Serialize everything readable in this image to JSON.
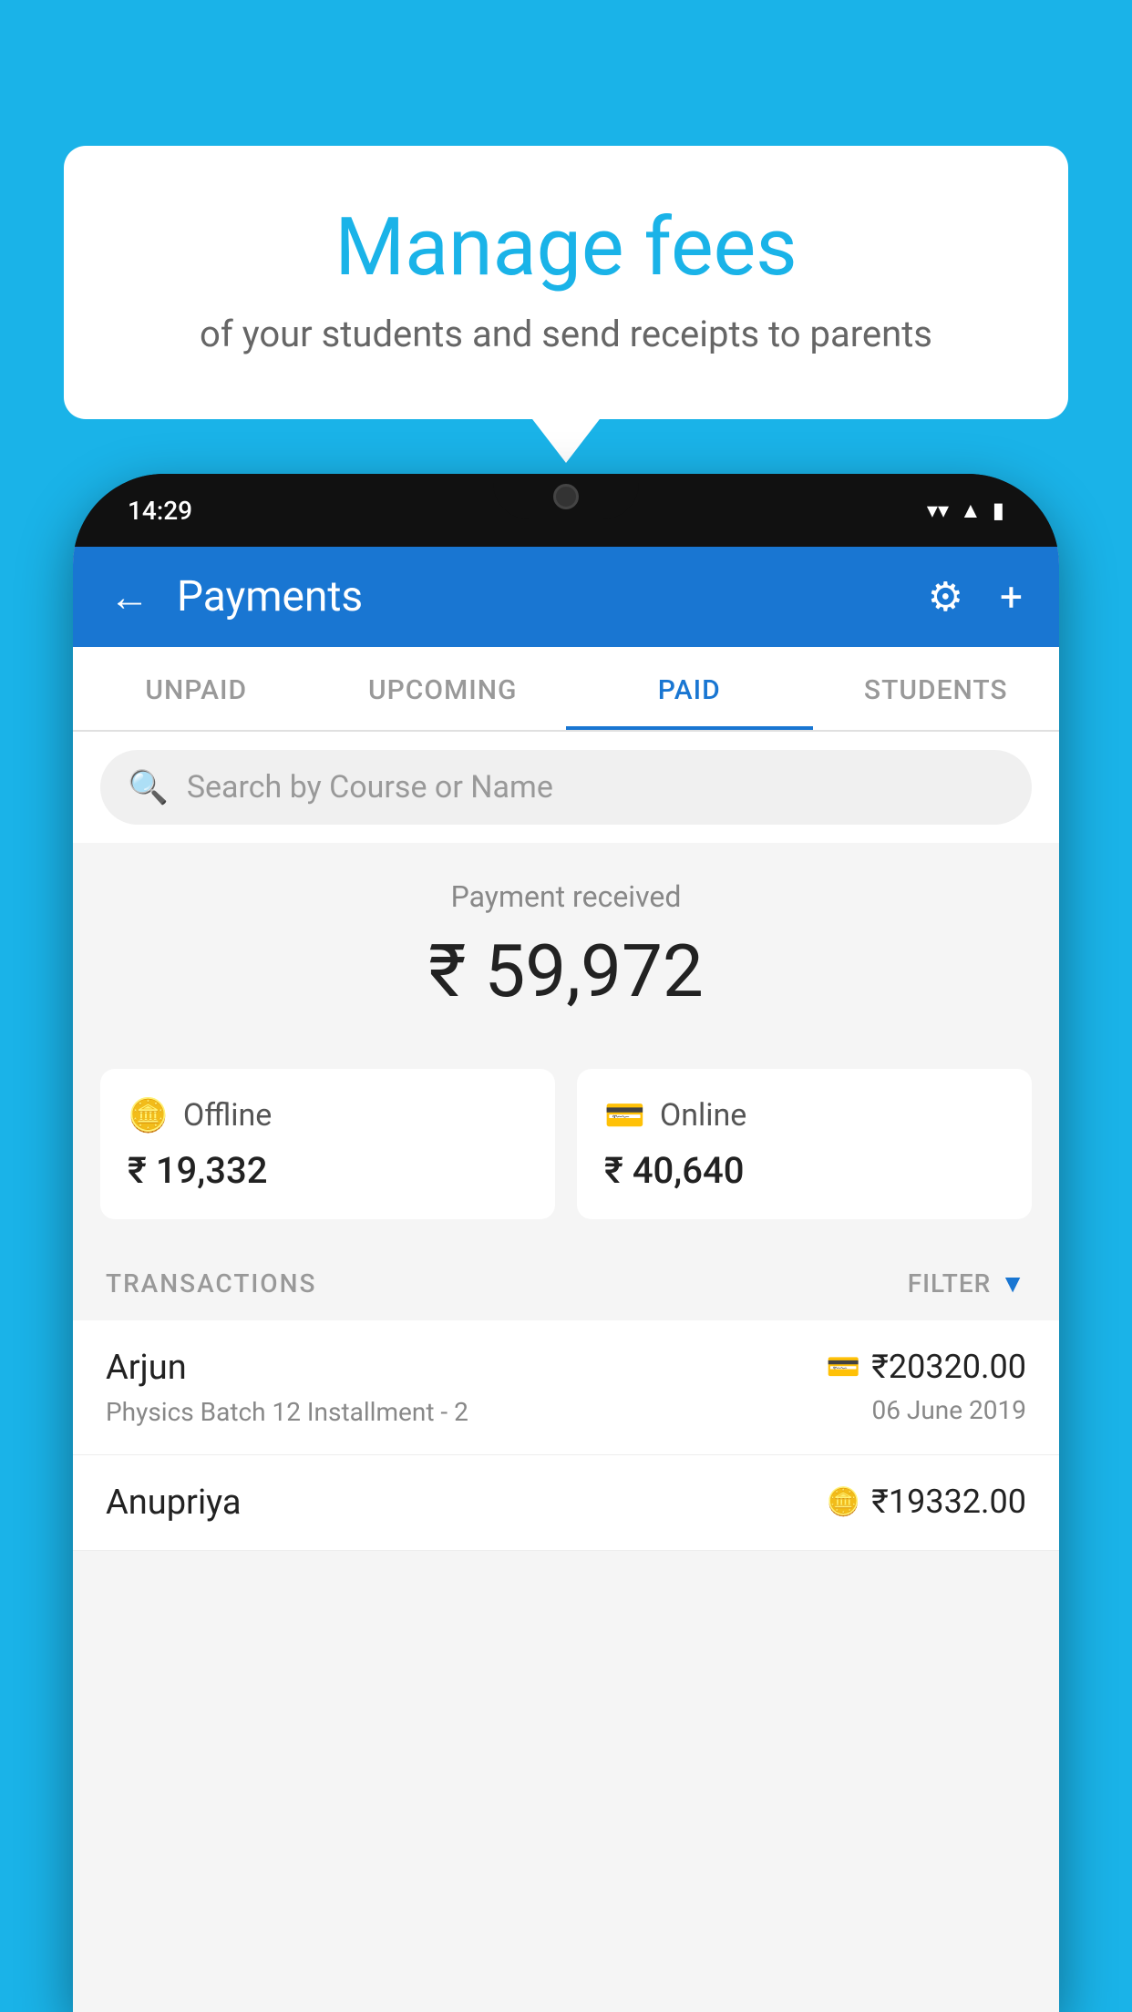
{
  "background_color": "#1ab3e8",
  "speech_bubble": {
    "title": "Manage fees",
    "subtitle": "of your students and send receipts to parents"
  },
  "status_bar": {
    "time": "14:29"
  },
  "header": {
    "title": "Payments",
    "back_label": "←",
    "gear_label": "⚙",
    "plus_label": "+"
  },
  "tabs": [
    {
      "label": "UNPAID",
      "active": false
    },
    {
      "label": "UPCOMING",
      "active": false
    },
    {
      "label": "PAID",
      "active": true
    },
    {
      "label": "STUDENTS",
      "active": false
    }
  ],
  "search": {
    "placeholder": "Search by Course or Name"
  },
  "payment_summary": {
    "received_label": "Payment received",
    "total_amount": "₹ 59,972",
    "offline": {
      "label": "Offline",
      "amount": "₹ 19,332"
    },
    "online": {
      "label": "Online",
      "amount": "₹ 40,640"
    }
  },
  "transactions_section": {
    "label": "TRANSACTIONS",
    "filter_label": "FILTER"
  },
  "transactions": [
    {
      "name": "Arjun",
      "course": "Physics Batch 12 Installment - 2",
      "amount": "₹20320.00",
      "date": "06 June 2019",
      "payment_type": "card"
    },
    {
      "name": "Anupriya",
      "course": "",
      "amount": "₹19332.00",
      "date": "",
      "payment_type": "offline"
    }
  ]
}
